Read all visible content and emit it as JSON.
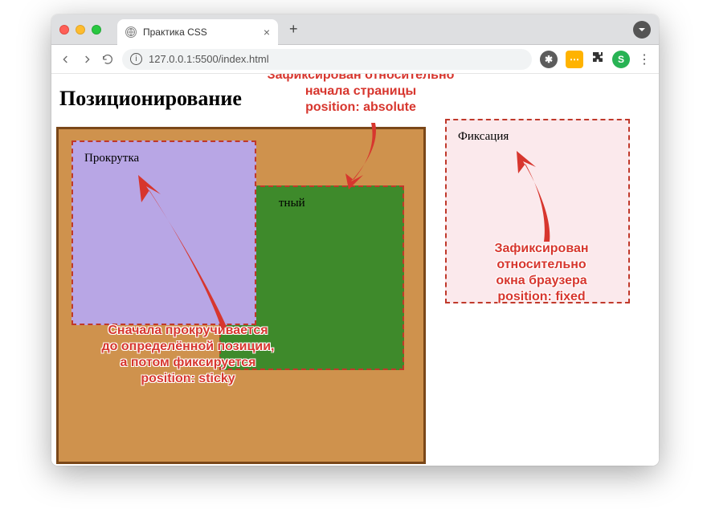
{
  "browser": {
    "tab_title": "Практика CSS",
    "url": "127.0.0.1:5500/index.html",
    "profile_letter": "S"
  },
  "page": {
    "heading": "Позиционирование",
    "sticky_label": "Прокрутка",
    "absolute_label": "тный",
    "fixed_label": "Фиксация"
  },
  "callouts": {
    "absolute": "Зафиксирован относительно\nначала страницы\nposition: absolute",
    "sticky": "Сначала прокручивается\nдо определённой позиции,\nа потом фиксируется\nposition: sticky",
    "fixed": "Зафиксирован\nотносительно\nокна браузера\nposition: fixed"
  },
  "colors": {
    "accent": "#d7362e",
    "container_bg": "#cf924d",
    "container_border": "#7a4718",
    "sticky_bg": "#b8a6e5",
    "absolute_bg": "#3e8a2b",
    "fixed_bg": "#fbe9ec",
    "dashed_border": "#c0392b"
  }
}
